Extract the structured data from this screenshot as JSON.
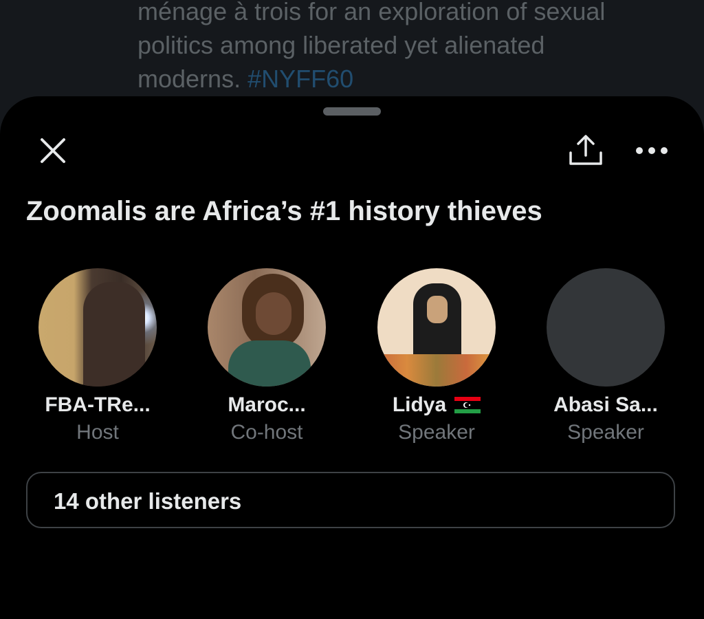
{
  "background_tweet": {
    "line1": "ménage à trois for an  exploration of sexual",
    "line2": "politics among liberated yet alienated",
    "line3_text": "moderns.",
    "hashtag": "#NYFF60"
  },
  "space": {
    "title": "Zoomalis are Africa’s #1 history thieves",
    "participants": [
      {
        "name": "FBA-TRe...",
        "role": "Host"
      },
      {
        "name": "Maroc...",
        "role": "Co-host"
      },
      {
        "name": "Lidya",
        "role": "Speaker",
        "flag": "libya-flag"
      },
      {
        "name": "Abasi Sa...",
        "role": "Speaker"
      }
    ],
    "listeners_label": "14 other listeners"
  },
  "icons": {
    "close": "close-icon",
    "share": "share-icon",
    "more": "more-icon"
  },
  "colors": {
    "background": "#000000",
    "text_primary": "#e7e9ea",
    "text_secondary": "#71767b",
    "hashtag": "#214d6f",
    "border": "#3e4246"
  }
}
